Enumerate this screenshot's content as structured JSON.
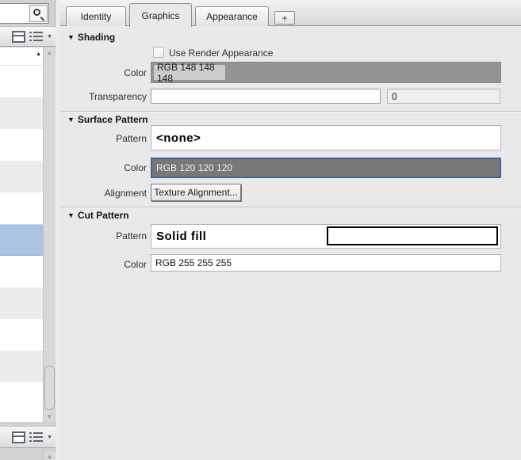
{
  "glyphs": {
    "collapse": "▼",
    "sort_asc": "▲",
    "caret_down": "▼",
    "scroll_up": "▲",
    "scroll_down": "▼"
  },
  "left_panel": {
    "search": {
      "value": ""
    },
    "list": {
      "rows": [
        {
          "state": "normal"
        },
        {
          "state": "alt"
        },
        {
          "state": "normal"
        },
        {
          "state": "alt"
        },
        {
          "state": "normal"
        },
        {
          "state": "selected"
        },
        {
          "state": "normal"
        },
        {
          "state": "alt"
        },
        {
          "state": "normal"
        },
        {
          "state": "alt"
        },
        {
          "state": "normal"
        }
      ],
      "selected_index": 5
    }
  },
  "tabs": {
    "items": [
      {
        "label": "Identity",
        "active": false
      },
      {
        "label": "Graphics",
        "active": true
      },
      {
        "label": "Appearance",
        "active": false
      }
    ],
    "add_label": "+"
  },
  "graphics": {
    "shading": {
      "title": "Shading",
      "use_render_appearance": {
        "label": "Use Render Appearance",
        "checked": false
      },
      "color": {
        "label": "Color",
        "value": "RGB 148 148 148"
      },
      "transparency": {
        "label": "Transparency",
        "value": "0"
      }
    },
    "surface_pattern": {
      "title": "Surface Pattern",
      "pattern": {
        "label": "Pattern",
        "value": "<none>"
      },
      "color": {
        "label": "Color",
        "value": "RGB 120 120 120"
      },
      "alignment": {
        "label": "Alignment",
        "button_label": "Texture Alignment..."
      }
    },
    "cut_pattern": {
      "title": "Cut Pattern",
      "pattern": {
        "label": "Pattern",
        "value": "Solid fill"
      },
      "color": {
        "label": "Color",
        "value": "RGB 255 255 255"
      }
    }
  },
  "colors": {
    "shading_swatch": "#949494",
    "surface_swatch": "#787878",
    "cut_swatch": "#ffffff",
    "selection_blue": "#abc3e3"
  }
}
